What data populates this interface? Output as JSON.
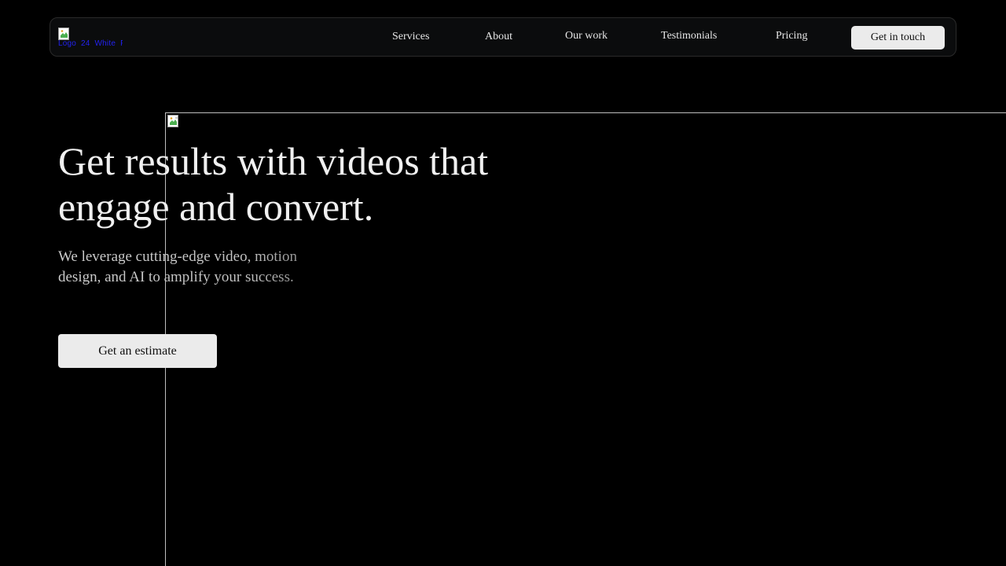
{
  "header": {
    "logo_alt": "Logo 24 White F",
    "nav": [
      {
        "label": "Services"
      },
      {
        "label": "About"
      },
      {
        "label": "Our work"
      },
      {
        "label": "Testimonials"
      },
      {
        "label": "Pricing"
      }
    ],
    "cta_label": "Get in touch"
  },
  "hero": {
    "title": "Get results with videos that engage and convert.",
    "subtitle": "We leverage cutting-edge video, motion design, and AI to amplify your success.",
    "cta_label": "Get an estimate"
  },
  "colors": {
    "background": "#000000",
    "button_bg": "#ebebeb",
    "text": "#ebebeb",
    "logo_alt_text": "#2222ee"
  }
}
